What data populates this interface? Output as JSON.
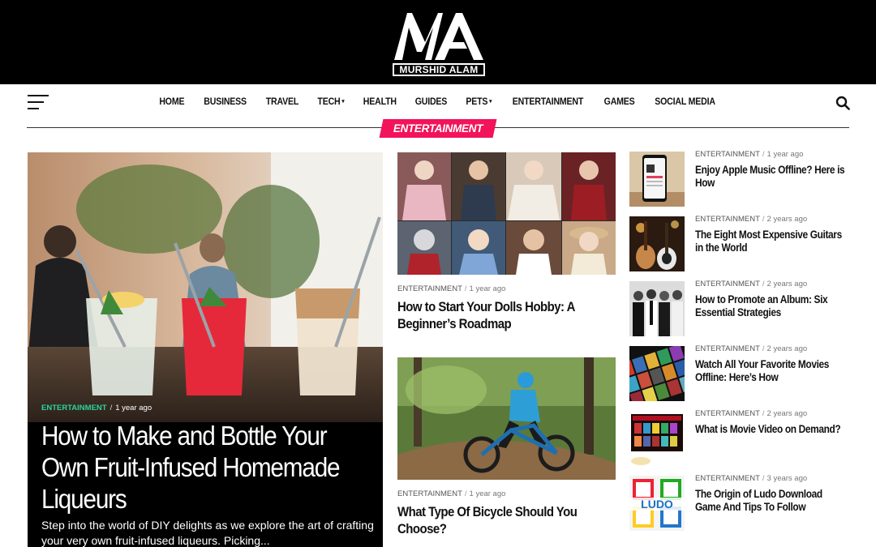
{
  "brand": {
    "logo_letters": "MA",
    "logo_text": "MURSHID ALAM"
  },
  "nav": {
    "items": [
      {
        "label": "HOME",
        "dropdown": false
      },
      {
        "label": "BUSINESS",
        "dropdown": false
      },
      {
        "label": "TRAVEL",
        "dropdown": false
      },
      {
        "label": "TECH",
        "dropdown": true
      },
      {
        "label": "HEALTH",
        "dropdown": false
      },
      {
        "label": "GUIDES",
        "dropdown": false
      },
      {
        "label": "PETS",
        "dropdown": true
      },
      {
        "label": "ENTERTAINMENT",
        "dropdown": false
      },
      {
        "label": "GAMES",
        "dropdown": false
      },
      {
        "label": "SOCIAL MEDIA",
        "dropdown": false
      }
    ],
    "menu_icon": "hamburger-icon",
    "search_icon": "search-icon"
  },
  "section": {
    "label": "ENTERTAINMENT",
    "color": "#f2135b"
  },
  "featured": {
    "category": "ENTERTAINMENT",
    "time": "1 year ago",
    "title": "How to Make and Bottle Your Own Fruit-Infused Homemade Liqueurs",
    "excerpt": "Step into the world of DIY delights as we explore the art of crafting your very own fruit-infused liqueurs. Picking..."
  },
  "middle": [
    {
      "category": "ENTERTAINMENT",
      "time": "1 year ago",
      "title": "How to Start Your Dolls Hobby: A Beginner’s Roadmap"
    },
    {
      "category": "ENTERTAINMENT",
      "time": "1 year ago",
      "title": "What Type Of Bicycle Should You Choose?"
    }
  ],
  "sidebar": [
    {
      "category": "ENTERTAINMENT",
      "time": "1 year ago",
      "title": "Enjoy Apple Music Offline? Here is How"
    },
    {
      "category": "ENTERTAINMENT",
      "time": "2 years ago",
      "title": "The Eight Most Expensive Guitars in the World"
    },
    {
      "category": "ENTERTAINMENT",
      "time": "2 years ago",
      "title": "How to Promote an Album: Six Essential Strategies"
    },
    {
      "category": "ENTERTAINMENT",
      "time": "2 years ago",
      "title": "Watch All Your Favorite Movies Offline: Here’s How"
    },
    {
      "category": "ENTERTAINMENT",
      "time": "2 years ago",
      "title": "What is Movie Video on Demand?"
    },
    {
      "category": "ENTERTAINMENT",
      "time": "3 years ago",
      "title": "The Origin of Ludo Download Game And Tips To Follow"
    }
  ],
  "ludo_thumb_text": "LUDO",
  "colors": {
    "accent": "#f2135b",
    "featured_category": "#2ad49e",
    "header_bg": "#000000"
  }
}
